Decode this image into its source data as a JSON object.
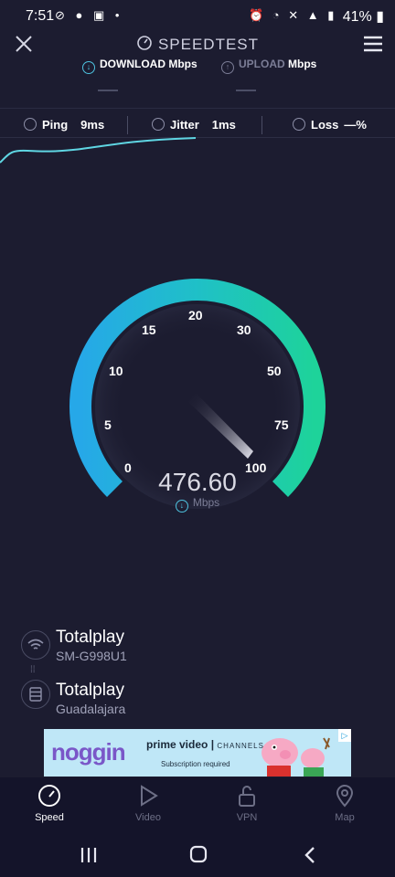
{
  "status_bar": {
    "time": "7:51",
    "battery": "41%"
  },
  "header": {
    "title": "SPEEDTEST",
    "download_label": "DOWNLOAD",
    "download_unit": "Mbps",
    "upload_label": "UPLOAD",
    "upload_unit": "Mbps"
  },
  "metrics": {
    "ping_label": "Ping",
    "ping_value": "9ms",
    "jitter_label": "Jitter",
    "jitter_value": "1ms",
    "loss_label": "Loss",
    "loss_value": "—%"
  },
  "gauge": {
    "ticks": [
      "0",
      "5",
      "10",
      "15",
      "20",
      "30",
      "50",
      "75",
      "100"
    ],
    "speed": "476.60",
    "unit": "Mbps"
  },
  "connection": {
    "client_provider": "Totalplay",
    "client_device": "SM-G998U1",
    "server_provider": "Totalplay",
    "server_location": "Guadalajara"
  },
  "ad": {
    "brand": "noggin",
    "service": "prime video",
    "channels": "CHANNELS",
    "note": "Subscription required"
  },
  "nav": {
    "speed": "Speed",
    "video": "Video",
    "vpn": "VPN",
    "map": "Map"
  },
  "colors": {
    "accent_cyan": "#29b6e6",
    "accent_green": "#1ed39a",
    "background": "#1c1c30"
  }
}
